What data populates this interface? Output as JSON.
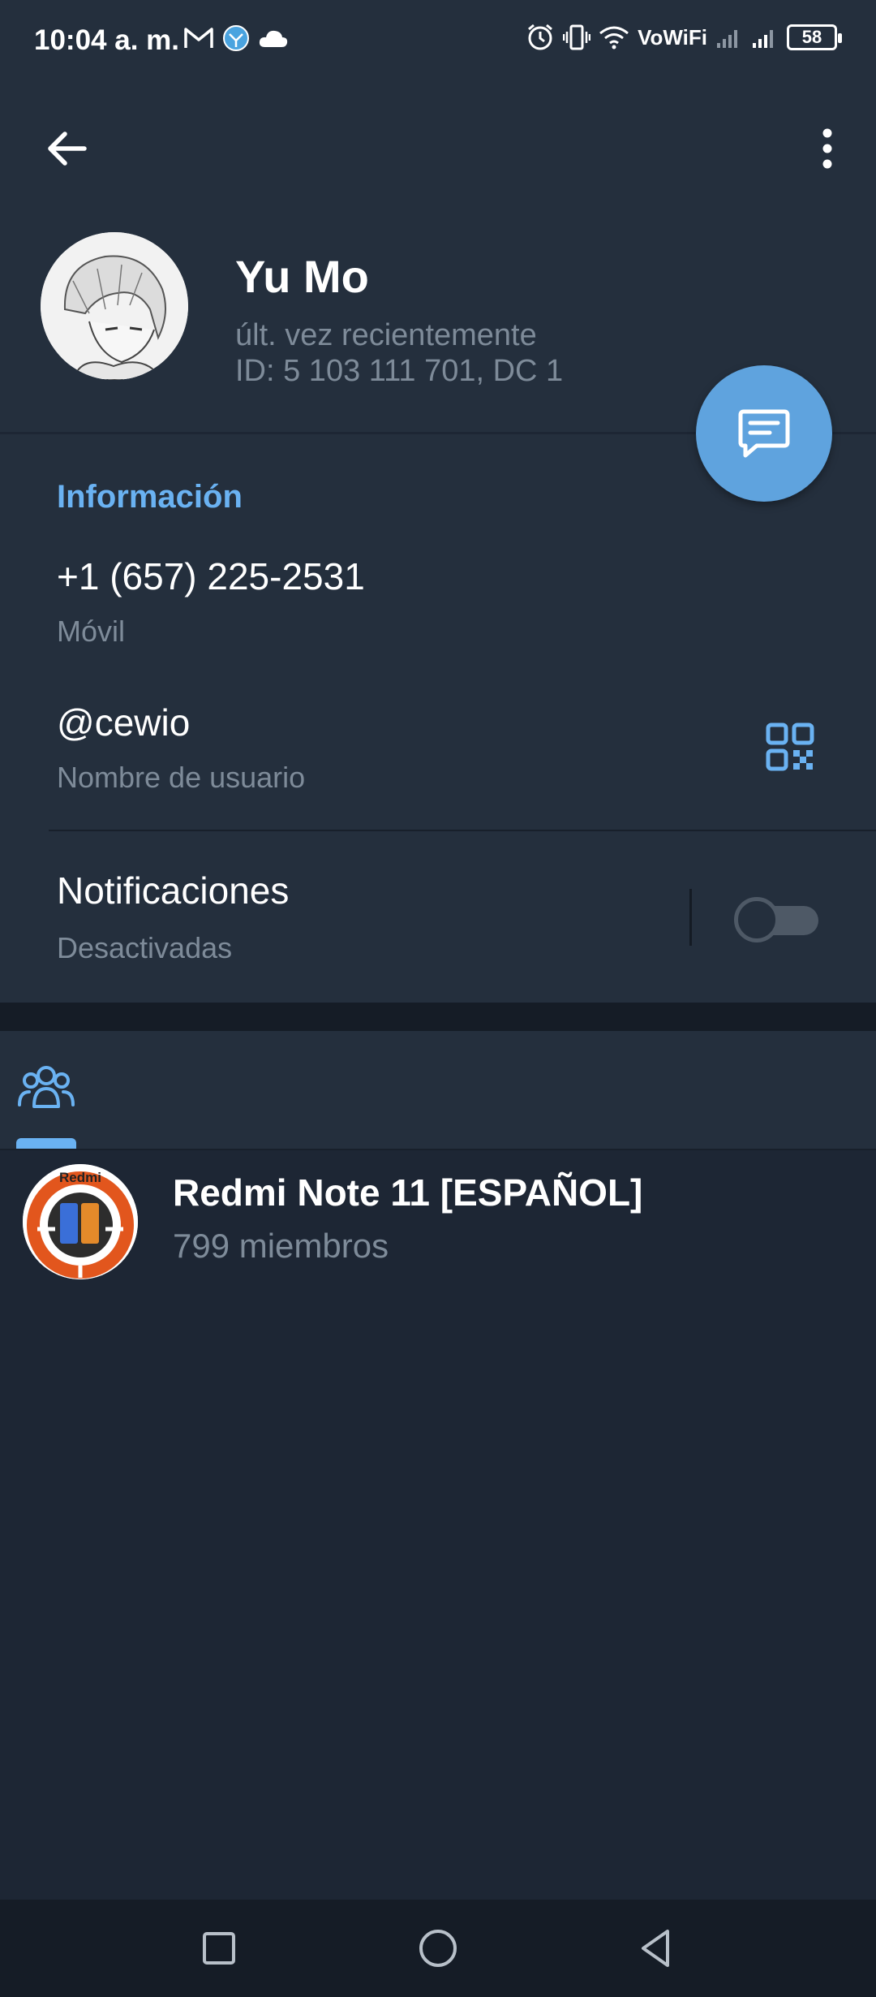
{
  "status_bar": {
    "time": "10:04 a. m.",
    "network": "VoWiFi",
    "battery": "58"
  },
  "profile": {
    "name": "Yu Mo",
    "last_seen": "últ. vez recientemente",
    "id_line": "ID: 5 103 111 701, DC 1"
  },
  "info": {
    "section_title": "Información",
    "phone": "+1 (657) 225-2531",
    "phone_label": "Móvil",
    "username": "@cewio",
    "username_label": "Nombre de usuario",
    "notifications": "Notificaciones",
    "notifications_status": "Desactivadas",
    "notifications_enabled": false
  },
  "tabs": [
    {
      "icon": "groups-icon",
      "active": true
    }
  ],
  "groups": [
    {
      "name": "Redmi Note 11 [ESPAÑOL]",
      "members": "799 miembros",
      "avatar_text": "Redmi"
    }
  ],
  "colors": {
    "background": "#1d2634",
    "surface": "#242f3d",
    "accent": "#6ab2f2",
    "fab": "#5fa3de",
    "secondary_text": "#7e8b99"
  }
}
